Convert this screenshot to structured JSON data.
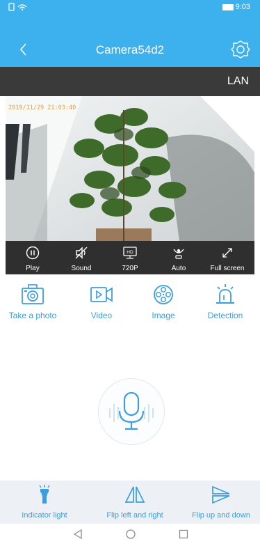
{
  "status_bar": {
    "time": "9:03"
  },
  "header": {
    "title": "Camera54d2"
  },
  "connection": {
    "mode": "LAN"
  },
  "video": {
    "timestamp": "2019/11/29 21:03:40"
  },
  "controls": [
    {
      "label": "Play",
      "icon": "pause-icon"
    },
    {
      "label": "Sound",
      "icon": "sound-muted-icon"
    },
    {
      "label": "720P",
      "icon": "hd-icon"
    },
    {
      "label": "Auto",
      "icon": "night-vision-icon"
    },
    {
      "label": "Full screen",
      "icon": "fullscreen-icon"
    }
  ],
  "actions": [
    {
      "label": "Take a photo",
      "icon": "camera-icon"
    },
    {
      "label": "Video",
      "icon": "video-record-icon"
    },
    {
      "label": "Image",
      "icon": "film-reel-icon"
    },
    {
      "label": "Detection",
      "icon": "alarm-icon"
    }
  ],
  "bottom": [
    {
      "label": "Indicator light",
      "icon": "flashlight-icon"
    },
    {
      "label": "Flip left and right",
      "icon": "flip-horizontal-icon"
    },
    {
      "label": "Flip up and down",
      "icon": "flip-vertical-icon"
    }
  ],
  "colors": {
    "accent": "#3cb1ee",
    "icon_blue": "#3c9ee0",
    "dark_bar": "#3a3a3a"
  }
}
